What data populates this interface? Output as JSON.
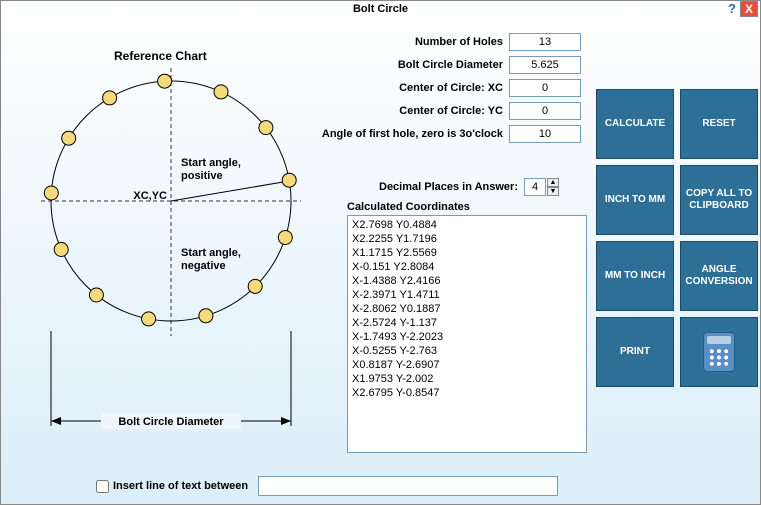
{
  "title": "Bolt Circle",
  "helpGlyph": "?",
  "closeGlyph": "X",
  "refChartTitle": "Reference Chart",
  "chart": {
    "startPos": "Start angle,\npositive",
    "startNeg": "Start angle,\nnegative",
    "center": "XC,YC",
    "diam": "Bolt Circle Diameter"
  },
  "form": {
    "numHoles": {
      "label": "Number of Holes",
      "value": "13"
    },
    "bcd": {
      "label": "Bolt Circle Diameter",
      "value": "5.625"
    },
    "xc": {
      "label": "Center of Circle: XC",
      "value": "0"
    },
    "yc": {
      "label": "Center of Circle: YC",
      "value": "0"
    },
    "angle": {
      "label": "Angle of first hole, zero is 3o'clock",
      "value": "10"
    }
  },
  "decimal": {
    "label": "Decimal Places in Answer:",
    "value": "4"
  },
  "coordLabel": "Calculated Coordinates",
  "coords": "X2.7698 Y0.4884\nX2.2255 Y1.7196\nX1.1715 Y2.5569\nX-0.151 Y2.8084\nX-1.4388 Y2.4166\nX-2.3971 Y1.4711\nX-2.8062 Y0.1887\nX-2.5724 Y-1.137\nX-1.7493 Y-2.2023\nX-0.5255 Y-2.763\nX0.8187 Y-2.6907\nX1.9753 Y-2.002\nX2.6795 Y-0.8547",
  "buttons": {
    "calc": "CALCULATE",
    "reset": "RESET",
    "in2mm": "INCH TO MM",
    "copy": "COPY ALL TO CLIPBOARD",
    "mm2in": "MM TO INCH",
    "angconv": "ANGLE CONVERSION",
    "print": "PRINT"
  },
  "insertLine": {
    "label": "Insert line of text between",
    "value": ""
  }
}
